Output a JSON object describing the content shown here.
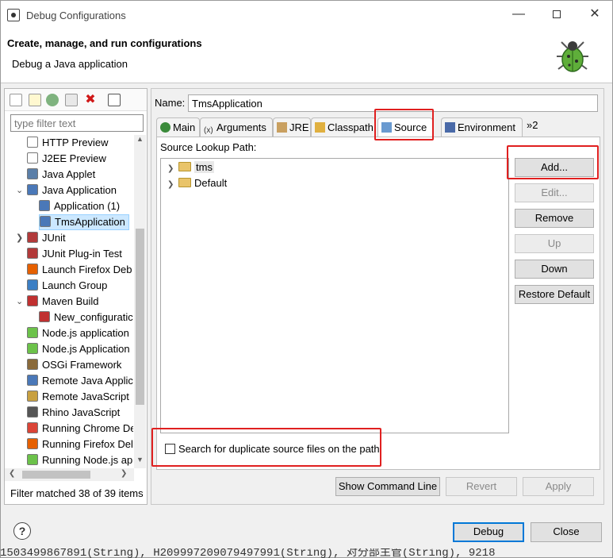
{
  "window": {
    "title": "Debug Configurations",
    "min_icon": "minimize-icon",
    "max_icon": "maximize-icon",
    "close_icon": "close-icon"
  },
  "header": {
    "title": "Create, manage, and run configurations",
    "subtitle": "Debug a Java application"
  },
  "left": {
    "toolbar_icons": [
      "new-configuration-icon",
      "new-prototype-icon",
      "duplicate-icon",
      "export-icon",
      "delete-icon",
      "collapse-all-icon"
    ],
    "filter_placeholder": "type filter text",
    "tree": [
      {
        "label": "HTTP Preview",
        "indent": 1,
        "icon": "http-preview-icon",
        "color": "#ffffff"
      },
      {
        "label": "J2EE Preview",
        "indent": 1,
        "icon": "j2ee-preview-icon",
        "color": "#ffffff"
      },
      {
        "label": "Java Applet",
        "indent": 1,
        "icon": "java-applet-icon",
        "color": "#5b7fa8"
      },
      {
        "label": "Java Application",
        "indent": 1,
        "icon": "java-application-icon",
        "color": "#4a78b8",
        "expanded": true
      },
      {
        "label": "Application (1)",
        "indent": 2,
        "icon": "java-config-icon",
        "color": "#4a78b8"
      },
      {
        "label": "TmsApplication",
        "indent": 2,
        "icon": "java-config-icon",
        "color": "#4a78b8",
        "selected": true
      },
      {
        "label": "JUnit",
        "indent": 1,
        "icon": "junit-icon",
        "color": "#b23a3a",
        "collapsed": true
      },
      {
        "label": "JUnit Plug-in Test",
        "indent": 1,
        "icon": "junit-plugin-icon",
        "color": "#b23a3a"
      },
      {
        "label": "Launch Firefox Deb",
        "indent": 1,
        "icon": "firefox-icon",
        "color": "#e66000"
      },
      {
        "label": "Launch Group",
        "indent": 1,
        "icon": "launch-group-icon",
        "color": "#3c7fc4"
      },
      {
        "label": "Maven Build",
        "indent": 1,
        "icon": "maven-icon",
        "color": "#c03030",
        "expanded": true
      },
      {
        "label": "New_configuratic",
        "indent": 2,
        "icon": "maven-icon",
        "color": "#c03030"
      },
      {
        "label": "Node.js application",
        "indent": 1,
        "icon": "nodejs-icon",
        "color": "#6cc24a"
      },
      {
        "label": "Node.js Application",
        "indent": 1,
        "icon": "nodejs-icon",
        "color": "#6cc24a"
      },
      {
        "label": "OSGi Framework",
        "indent": 1,
        "icon": "osgi-icon",
        "color": "#8a6a3a"
      },
      {
        "label": "Remote Java Applic",
        "indent": 1,
        "icon": "remote-java-icon",
        "color": "#4a78b8"
      },
      {
        "label": "Remote JavaScript",
        "indent": 1,
        "icon": "remote-javascript-icon",
        "color": "#c8a040"
      },
      {
        "label": "Rhino JavaScript",
        "indent": 1,
        "icon": "rhino-icon",
        "color": "#555555"
      },
      {
        "label": "Running Chrome De",
        "indent": 1,
        "icon": "chrome-icon",
        "color": "#db4437"
      },
      {
        "label": "Running Firefox Del",
        "indent": 1,
        "icon": "firefox-icon",
        "color": "#e66000"
      },
      {
        "label": "Running Node.js ap",
        "indent": 1,
        "icon": "nodejs-icon",
        "color": "#6cc24a"
      }
    ],
    "filter_info": "Filter matched 38 of 39 items"
  },
  "right": {
    "name_label": "Name:",
    "name_value": "TmsApplication",
    "tabs": [
      {
        "label": "Main",
        "icon": "main-tab-icon",
        "active": false
      },
      {
        "label": "Arguments",
        "icon": "arguments-tab-icon",
        "active": false
      },
      {
        "label": "JRE",
        "icon": "jre-tab-icon",
        "active": false
      },
      {
        "label": "Classpath",
        "icon": "classpath-tab-icon",
        "active": false
      },
      {
        "label": "Source",
        "icon": "source-tab-icon",
        "active": true
      },
      {
        "label": "Environment",
        "icon": "environment-tab-icon",
        "active": false
      }
    ],
    "tabs_overflow": "»2",
    "source_lookup_label": "Source Lookup Path:",
    "source_entries": [
      {
        "label": "tms",
        "selected": true
      },
      {
        "label": "Default",
        "selected": false
      }
    ],
    "buttons": {
      "add": "Add...",
      "edit": "Edit...",
      "remove": "Remove",
      "up": "Up",
      "down": "Down",
      "restore": "Restore Default"
    },
    "duplicate_checkbox": "Search for duplicate source files on the path",
    "show_command_line": "Show Command Line",
    "revert": "Revert",
    "apply": "Apply"
  },
  "footer": {
    "help_icon": "help-icon",
    "debug": "Debug",
    "close": "Close"
  },
  "background_code": "1503499867891(String), H209997209079497991(String), 对分部主管(String), 9218"
}
